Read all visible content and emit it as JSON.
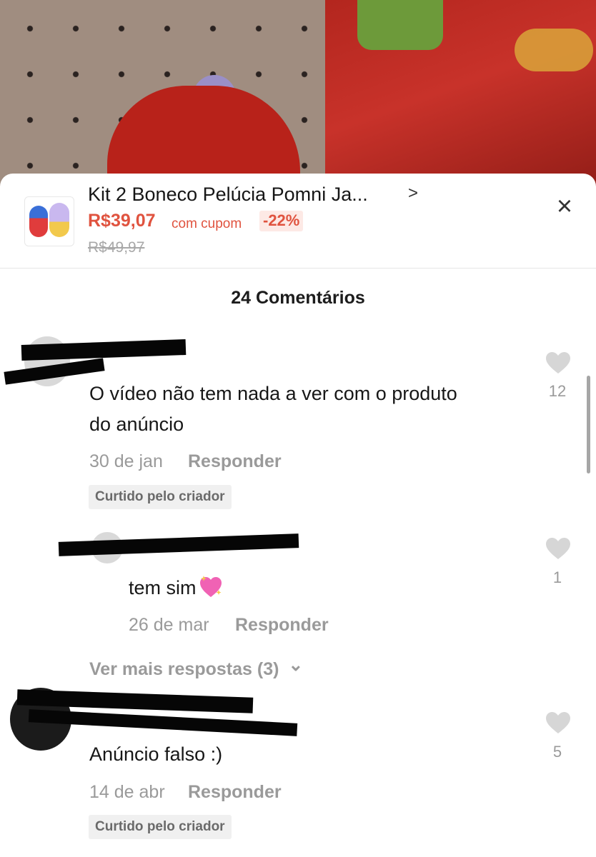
{
  "product": {
    "title": "Kit 2 Boneco Pelúcia Pomni Ja...",
    "chevron": ">",
    "price": "R$39,07",
    "coupon_label": "com cupom",
    "discount": "-22%",
    "old_price": "R$49,97",
    "close_icon": "×"
  },
  "comments_header": "24 Comentários",
  "comments": [
    {
      "text_line1": "O vídeo não tem nada a ver com o produto",
      "text_line2": "do anúncio",
      "date": "30 de jan",
      "reply_label": "Responder",
      "badge": "Curtido pelo criador",
      "likes": "12"
    },
    {
      "text": "tem sim",
      "emoji": "sparkling-heart-icon",
      "date": "26 de mar",
      "reply_label": "Responder",
      "likes": "1"
    },
    {
      "text": "Anúncio falso :)",
      "date": "14 de abr",
      "reply_label": "Responder",
      "badge": "Curtido pelo criador",
      "likes": "5"
    }
  ],
  "more_replies": "Ver mais respostas (3)",
  "more_chevron": "⌄",
  "colors": {
    "accent": "#e0533f",
    "muted": "#9a9a9a",
    "heart": "#d6d6d6"
  }
}
